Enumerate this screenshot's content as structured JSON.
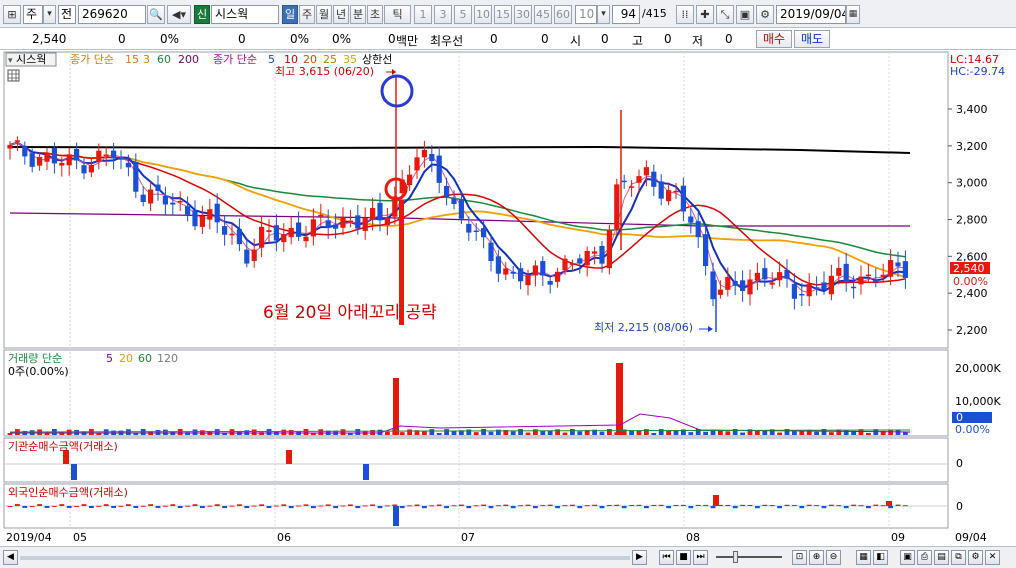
{
  "toolbar": {
    "market_type": "주",
    "market_dropdown": "▾",
    "all_label": "전",
    "stock_code": "269620",
    "stock_name": "시스웍",
    "new_label": "신",
    "periods": [
      "일",
      "주",
      "월",
      "년",
      "분",
      "초",
      "틱"
    ],
    "active_period": "일",
    "intervals": [
      "1",
      "3",
      "5",
      "10",
      "15",
      "30",
      "45",
      "60"
    ],
    "count_value": "10",
    "display_count": "94",
    "total_count": "/415",
    "date": "2019/09/04"
  },
  "quote": {
    "price": "2,540",
    "change": "0",
    "change_rate": "0%",
    "volume": "0",
    "volume_rate": "0%",
    "amount": "0",
    "amount_unit": "백만",
    "best_bid_label": "최우선",
    "best_bid_value": "0",
    "best_ask_value": "0",
    "open_label": "시",
    "open_value": "0",
    "high_label": "고",
    "high_value": "0",
    "low_label": "저",
    "low_value": "0",
    "buy_button": "매수",
    "sell_button": "매도"
  },
  "price_panel": {
    "tab_label": "시스웍",
    "legend_close_ma": "종가 단순",
    "legend_close_periods": [
      "15",
      "3",
      "60",
      "200"
    ],
    "legend_close_colors": [
      "#e07b00",
      "#e07b00",
      "#1a8a3a",
      "#7a0080"
    ],
    "legend_volume_ma": "종가 단순",
    "legend_volume_periods": [
      "5",
      "10",
      "20",
      "25",
      "35"
    ],
    "legend_volume_colors": [
      "#1a3fd6",
      "#d60000",
      "#d64a00",
      "#c07a00",
      "#e0a000"
    ],
    "upper_limit_line": "상한선",
    "lc_label": "LC:14.67",
    "hc_label": "HC:-29.74",
    "y_ticks": [
      "3,400",
      "3,200",
      "3,000",
      "2,800",
      "2,600",
      "2,400",
      "2,200"
    ],
    "current_price_tag": "2,540",
    "current_rate_tag": "0.00%",
    "high_annotation": "최고 3,615 (06/20)",
    "low_annotation": "최저 2,215 (08/06)",
    "note": "6월 20일 아래꼬리 공략"
  },
  "volume_panel": {
    "label": "거래량 단순",
    "ma_periods": [
      "5",
      "20",
      "60",
      "120"
    ],
    "ma_colors": [
      "#8000a0",
      "#e0a000",
      "#1a8a3a",
      "#7a7a7a"
    ],
    "sub_label": "0주(0.00%)",
    "y_ticks": [
      "20,000K",
      "10,000K"
    ],
    "current_tag": "0",
    "rate_tag": "0.00%"
  },
  "inst_panel": {
    "label": "기관순매수금액(거래소)",
    "y_tick": "0"
  },
  "foreign_panel": {
    "label": "외국인순매수금액(거래소)",
    "y_tick": "0"
  },
  "x_axis": {
    "labels": [
      "2019/04",
      "05",
      "06",
      "07",
      "08",
      "09"
    ],
    "right_label": "09/04"
  },
  "colors": {
    "up": "#e8190c",
    "down": "#1a4fd6",
    "ma_black": "#000000",
    "ma_green": "#1a8a3a",
    "ma_orange": "#f2a000",
    "ma_red": "#e00000",
    "ma_blue": "#1030c0",
    "ma_purple": "#7a0080"
  }
}
